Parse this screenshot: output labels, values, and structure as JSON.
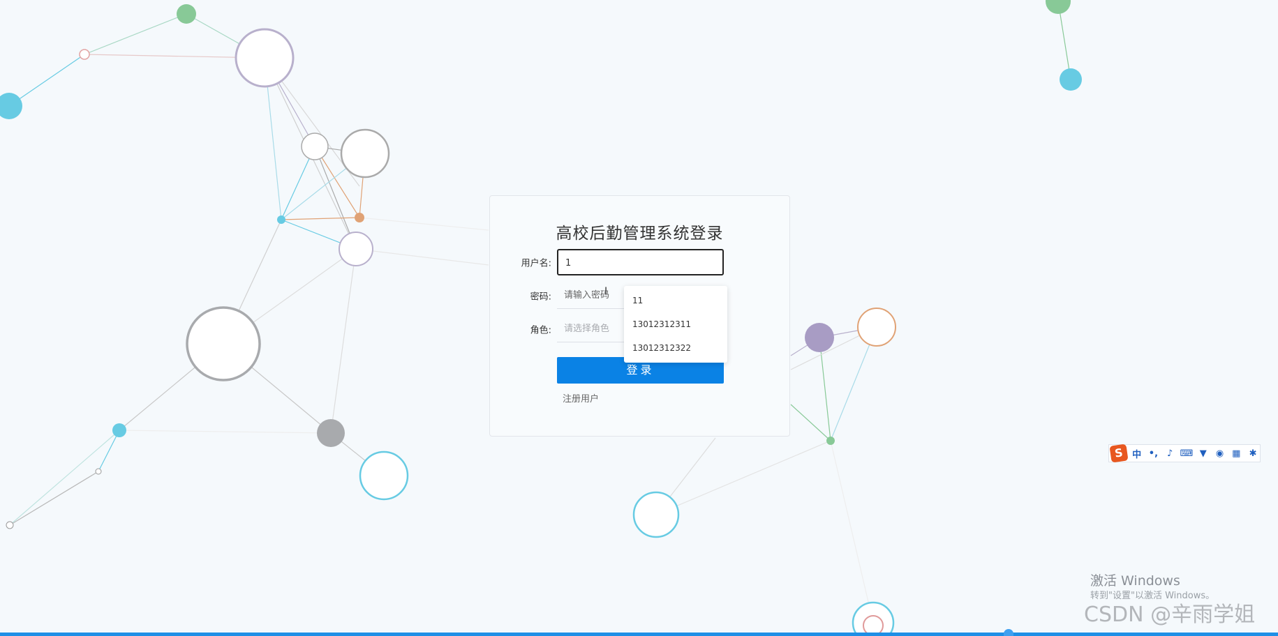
{
  "login": {
    "title": "高校后勤管理系统登录",
    "username_label": "用户名:",
    "username_value": "1",
    "password_label": "密码:",
    "password_placeholder": "请输入密码",
    "role_label": "角色:",
    "role_placeholder": "请选择角色",
    "submit_label": "登录",
    "register_label": "注册用户"
  },
  "autocomplete": {
    "items": [
      "11",
      "13012312311",
      "13012312322"
    ]
  },
  "ime": {
    "logo": "S",
    "mode": "中",
    "icons": [
      "punctuation-icon",
      "microphone-icon",
      "keyboard-icon",
      "skin-icon",
      "game-icon",
      "apps-icon",
      "settings-icon"
    ]
  },
  "watermark": {
    "title": "激活 Windows",
    "subtitle": "转到\"设置\"以激活 Windows。",
    "csdn": "CSDN @辛雨学姐"
  },
  "colors": {
    "accent": "#0a82e5",
    "background": "#f5f9fc",
    "node_green": "#88c997",
    "node_cyan": "#67cbe3",
    "node_purple": "#a89cc4",
    "node_orange": "#e0a275",
    "node_gray": "#a8aaad"
  }
}
